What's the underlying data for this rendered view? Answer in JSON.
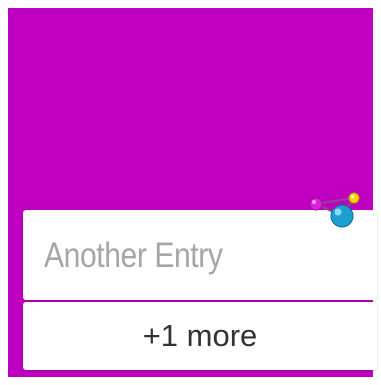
{
  "screen": {
    "background_color": "#c000c0"
  },
  "entry_card": {
    "title": "Another Entry"
  },
  "more_card": {
    "label": "+1 more"
  },
  "app_icon": {
    "name": "molecule-app-icon",
    "colors": {
      "magenta": "#e020e0",
      "yellow": "#f5d800",
      "blue": "#1aa0d0"
    }
  }
}
